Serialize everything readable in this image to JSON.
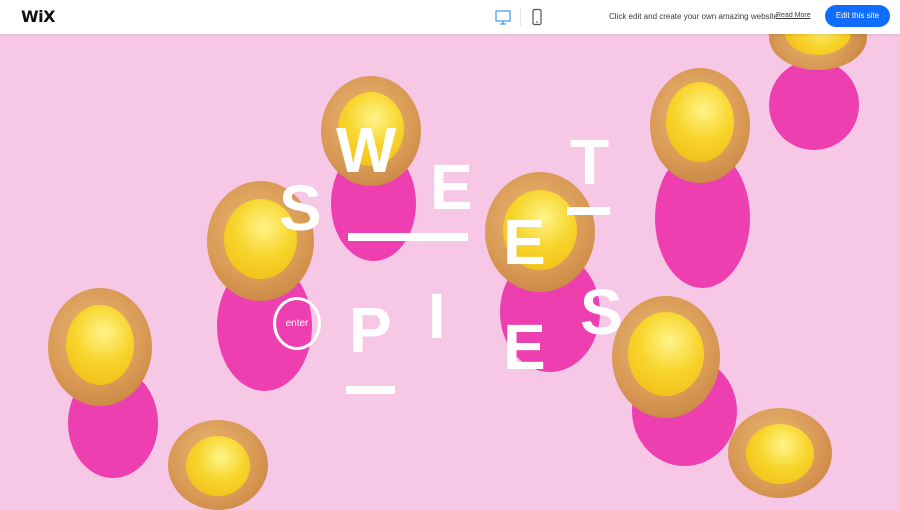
{
  "topbar": {
    "logo_text": "WiX",
    "desktop_icon": "desktop-icon",
    "mobile_icon": "mobile-icon",
    "tagline": "Click edit and create your own amazing website",
    "read_more": "Read More",
    "edit_button": "Edit this site"
  },
  "hero": {
    "title_letters": {
      "s1": "S",
      "w": "W",
      "e1": "E",
      "e2": "E",
      "t": "T",
      "s2": "S",
      "p": "P",
      "i": "I",
      "e3": "E"
    },
    "enter_label": "enter"
  },
  "colors": {
    "background": "#f6c8e6",
    "shadow": "#ee3fb0",
    "accent_button": "#116dff",
    "text": "#ffffff"
  }
}
